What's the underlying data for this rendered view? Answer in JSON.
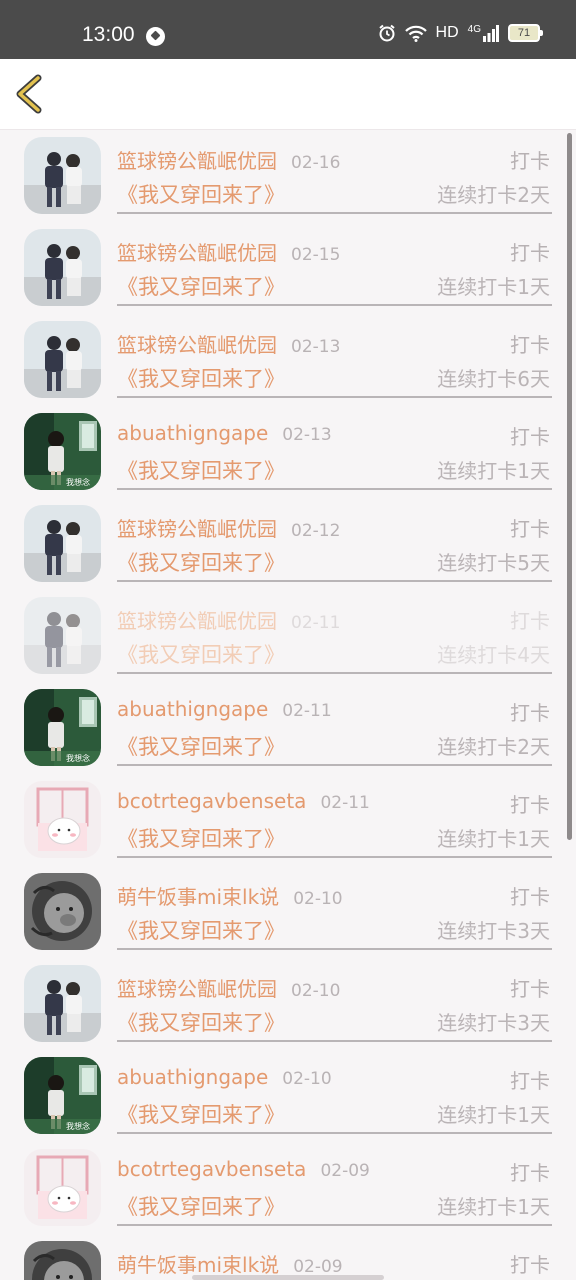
{
  "status": {
    "time": "13:00",
    "network": "HD",
    "signal": "4G",
    "battery": "71"
  },
  "header": {
    "back_icon": "chevron-left-icon"
  },
  "colors": {
    "accent": "#e49a6f",
    "muted": "#b9b3b5",
    "back": "#e3c24f"
  },
  "rows": [
    {
      "name": "篮球镑公甑岷优园",
      "date": "02-16",
      "action": "打卡",
      "title": "《我又穿回来了》",
      "streak": "连续打卡2天",
      "avatar": "couple"
    },
    {
      "name": "篮球镑公甑岷优园",
      "date": "02-15",
      "action": "打卡",
      "title": "《我又穿回来了》",
      "streak": "连续打卡1天",
      "avatar": "couple"
    },
    {
      "name": "篮球镑公甑岷优园",
      "date": "02-13",
      "action": "打卡",
      "title": "《我又穿回来了》",
      "streak": "连续打卡6天",
      "avatar": "couple"
    },
    {
      "name": "abuathigngape",
      "date": "02-13",
      "action": "打卡",
      "title": "《我又穿回来了》",
      "streak": "连续打卡1天",
      "avatar": "girl",
      "avatar_text": "我想念"
    },
    {
      "name": "篮球镑公甑岷优园",
      "date": "02-12",
      "action": "打卡",
      "title": "《我又穿回来了》",
      "streak": "连续打卡5天",
      "avatar": "couple"
    },
    {
      "name": "篮球镑公甑岷优园",
      "date": "02-11",
      "action": "打卡",
      "title": "《我又穿回来了》",
      "streak": "连续打卡4天",
      "avatar": "couple",
      "faded": true
    },
    {
      "name": "abuathigngape",
      "date": "02-11",
      "action": "打卡",
      "title": "《我又穿回来了》",
      "streak": "连续打卡2天",
      "avatar": "girl",
      "avatar_text": "我想念"
    },
    {
      "name": "bcotrtegavbenseta",
      "date": "02-11",
      "action": "打卡",
      "title": "《我又穿回来了》",
      "streak": "连续打卡1天",
      "avatar": "cat"
    },
    {
      "name": "萌牛饭事mi束lk说",
      "date": "02-10",
      "action": "打卡",
      "title": "《我又穿回来了》",
      "streak": "连续打卡3天",
      "avatar": "lion"
    },
    {
      "name": "篮球镑公甑岷优园",
      "date": "02-10",
      "action": "打卡",
      "title": "《我又穿回来了》",
      "streak": "连续打卡3天",
      "avatar": "couple"
    },
    {
      "name": "abuathigngape",
      "date": "02-10",
      "action": "打卡",
      "title": "《我又穿回来了》",
      "streak": "连续打卡1天",
      "avatar": "girl",
      "avatar_text": "我想念"
    },
    {
      "name": "bcotrtegavbenseta",
      "date": "02-09",
      "action": "打卡",
      "title": "《我又穿回来了》",
      "streak": "连续打卡1天",
      "avatar": "cat"
    },
    {
      "name": "萌牛饭事mi束lk说",
      "date": "02-09",
      "action": "打卡",
      "title": "",
      "streak": "",
      "avatar": "lion"
    }
  ]
}
